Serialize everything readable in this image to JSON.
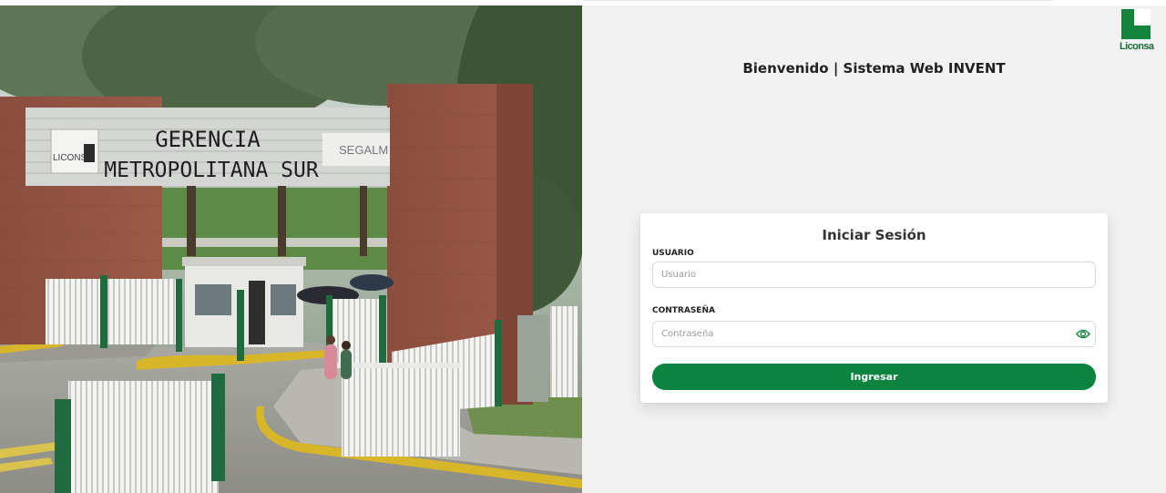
{
  "photo": {
    "sign_line1": "GERENCIA",
    "sign_line2": "METROPOLITANA SUR",
    "sign_logo_left": "LICONSA",
    "sign_logo_right": "SEGALM"
  },
  "brand": {
    "logo_text": "Liconsa",
    "color": "#14833b"
  },
  "header": {
    "welcome": "Bienvenido | Sistema Web INVENT"
  },
  "login": {
    "title": "Iniciar Sesión",
    "user_label": "USUARIO",
    "user_placeholder": "Usuario",
    "pass_label": "CONTRASEÑA",
    "pass_placeholder": "Contraseña",
    "submit_label": "Ingresar",
    "button_color": "#0c8440",
    "toggle_icon": "eye-icon"
  }
}
